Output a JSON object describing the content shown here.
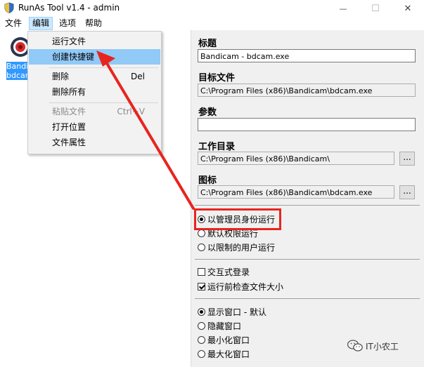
{
  "window": {
    "title": "RunAs Tool v1.4 - admin",
    "minimize_glyph": "—",
    "maximize_glyph": "☐",
    "close_glyph": "✕"
  },
  "menubar": {
    "items": [
      {
        "label": "文件"
      },
      {
        "label": "编辑"
      },
      {
        "label": "选项"
      },
      {
        "label": "帮助"
      }
    ]
  },
  "list": {
    "items": [
      {
        "line1": "Bandicam - bdcam.exe",
        "line2": "bdcam.exe"
      }
    ]
  },
  "dropdown": {
    "items": [
      {
        "label": "运行文件",
        "shortcut": ""
      },
      {
        "label": "创建快捷键",
        "shortcut": ""
      },
      {
        "label": "删除",
        "shortcut": "Del"
      },
      {
        "label": "删除所有",
        "shortcut": ""
      },
      {
        "label": "粘贴文件",
        "shortcut": "Ctrl+V"
      },
      {
        "label": "打开位置",
        "shortcut": ""
      },
      {
        "label": "文件属性",
        "shortcut": ""
      }
    ]
  },
  "form": {
    "title_label": "标题",
    "title_value": "Bandicam - bdcam.exe",
    "target_label": "目标文件",
    "target_value": "C:\\Program Files (x86)\\Bandicam\\bdcam.exe",
    "params_label": "参数",
    "params_value": "",
    "workdir_label": "工作目录",
    "workdir_value": "C:\\Program Files (x86)\\Bandicam\\",
    "icon_label": "图标",
    "icon_value": "C:\\Program Files (x86)\\Bandicam\\bdcam.exe",
    "browse_label": "..."
  },
  "run_mode": {
    "options": [
      {
        "label": "以管理员身份运行",
        "selected": true
      },
      {
        "label": "默认权限运行",
        "selected": false
      },
      {
        "label": "以限制的用户运行",
        "selected": false
      }
    ]
  },
  "checks": {
    "options": [
      {
        "label": "交互式登录",
        "checked": false
      },
      {
        "label": "运行前检查文件大小",
        "checked": true
      }
    ]
  },
  "window_mode": {
    "options": [
      {
        "label": "显示窗口 - 默认",
        "selected": true
      },
      {
        "label": "隐藏窗口",
        "selected": false
      },
      {
        "label": "最小化窗口",
        "selected": false
      },
      {
        "label": "最大化窗口",
        "selected": false
      }
    ]
  },
  "watermark": {
    "text": "IT小农工"
  },
  "colors": {
    "highlight_red": "#e8241f",
    "menu_hover": "#91c9f7"
  }
}
